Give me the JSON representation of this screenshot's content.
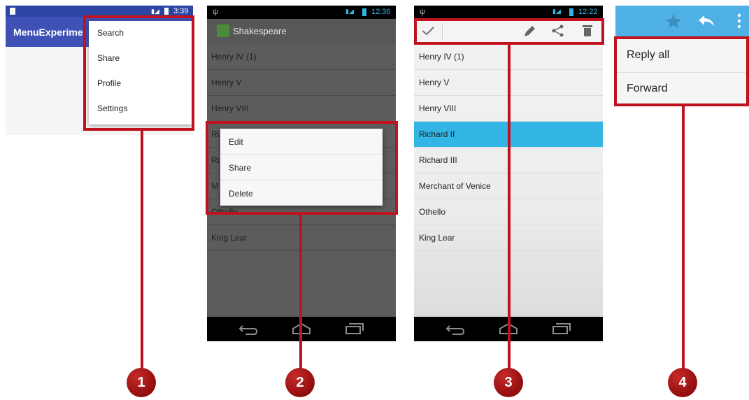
{
  "panel1": {
    "status_time": "3:39",
    "status_icons": "",
    "app_title": "MenuExperime",
    "menu_items": [
      "Search",
      "Share",
      "Profile",
      "Settings"
    ]
  },
  "panel2": {
    "status_time": "12:36",
    "app_title": "Shakespeare",
    "list_items": [
      "Henry IV (1)",
      "Henry V",
      "Henry VIII",
      "Ri",
      "Ri",
      "M",
      "Othello",
      "King Lear"
    ],
    "context_menu": [
      "Edit",
      "Share",
      "Delete"
    ]
  },
  "panel3": {
    "status_time": "12:22",
    "list_items": [
      "Henry IV (1)",
      "Henry V",
      "Henry VIII",
      "Richard II",
      "Richard III",
      "Merchant of Venice",
      "Othello",
      "King Lear"
    ],
    "selected": "Richard II",
    "colors": {
      "selected": "#33b5e5"
    }
  },
  "panel4": {
    "menu_items": [
      "Reply all",
      "Forward"
    ],
    "colors": {
      "appbar": "#4fb0e6"
    }
  },
  "callouts": [
    "1",
    "2",
    "3",
    "4"
  ],
  "colors": {
    "callout": "#c0111f"
  }
}
